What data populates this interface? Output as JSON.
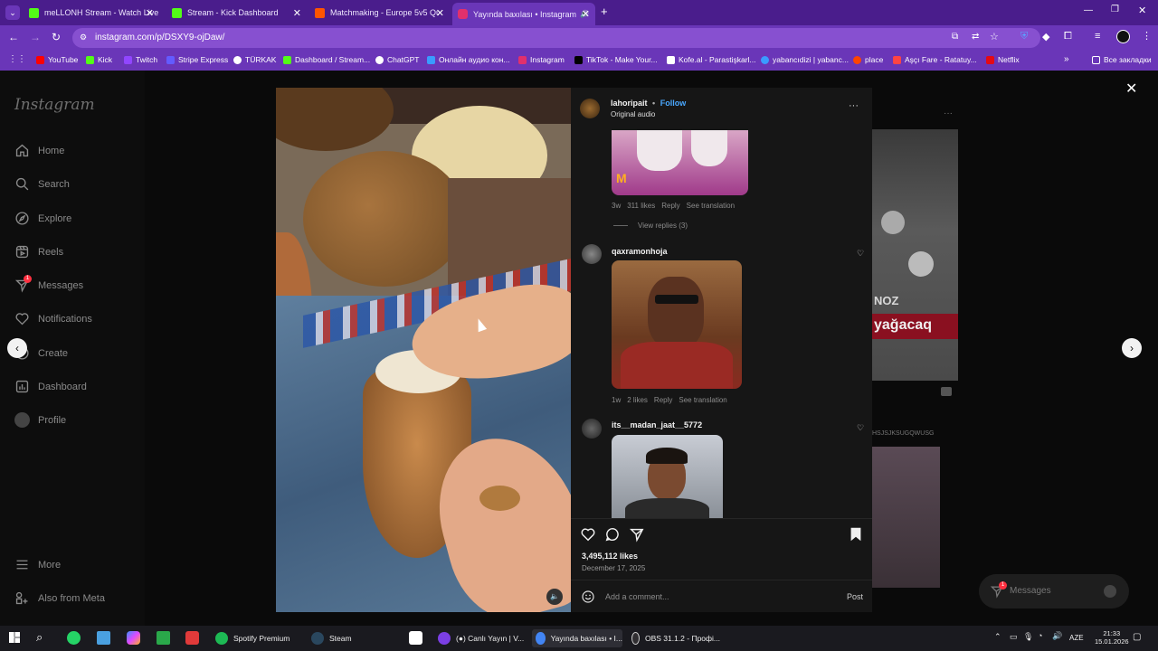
{
  "browser": {
    "tabs": [
      {
        "label": "meLLONH Stream - Watch Live",
        "icon": "kick-icon",
        "color": "#53fc18"
      },
      {
        "label": "Stream - Kick Dashboard",
        "icon": "kick-icon",
        "color": "#53fc18"
      },
      {
        "label": "Matchmaking - Europe 5v5 Qu",
        "icon": "faceit-icon",
        "color": "#ff5500"
      },
      {
        "label": "Yayında baxılası • Instagram",
        "icon": "instagram-icon",
        "color": "#e1306c"
      }
    ],
    "url": "instagram.com/p/DSXY9-ojDaw/",
    "bookmarks": [
      {
        "label": "YouTube",
        "color": "#ff0000"
      },
      {
        "label": "Kick",
        "color": "#53fc18"
      },
      {
        "label": "Twitch",
        "color": "#9146ff"
      },
      {
        "label": "Stripe Express",
        "color": "#635bff"
      },
      {
        "label": "TÜRKAK",
        "color": "#ffffff"
      },
      {
        "label": "Dashboard / Stream...",
        "color": "#53fc18"
      },
      {
        "label": "ChatGPT",
        "color": "#ffffff"
      },
      {
        "label": "Онлайн аудио кон...",
        "color": "#3a9bff"
      },
      {
        "label": "Instagram",
        "color": "#e1306c"
      },
      {
        "label": "TikTok - Make Your...",
        "color": "#000000"
      },
      {
        "label": "Kofe.al - Parastişkarl...",
        "color": "#ffffff"
      },
      {
        "label": "yabancıdizi | yabanc...",
        "color": "#3a9bff"
      },
      {
        "label": "place",
        "color": "#ff4500"
      },
      {
        "label": "Aşçı Fare - Ratatuy...",
        "color": "#ff4444"
      },
      {
        "label": "Netflix",
        "color": "#e50914"
      }
    ],
    "other_bookmarks": "Все закладки"
  },
  "sidebar": {
    "logo": "Instagram",
    "items": [
      {
        "label": "Home",
        "icon": "home-icon"
      },
      {
        "label": "Search",
        "icon": "search-icon"
      },
      {
        "label": "Explore",
        "icon": "explore-icon"
      },
      {
        "label": "Reels",
        "icon": "reels-icon"
      },
      {
        "label": "Messages",
        "icon": "messages-icon",
        "badge": "1"
      },
      {
        "label": "Notifications",
        "icon": "heart-icon"
      },
      {
        "label": "Create",
        "icon": "plus-icon"
      },
      {
        "label": "Dashboard",
        "icon": "dashboard-icon"
      },
      {
        "label": "Profile",
        "icon": "avatar"
      }
    ],
    "more": "More",
    "meta": "Also from Meta"
  },
  "post": {
    "username": "lahoripait",
    "follow": "Follow",
    "audio": "Original audio",
    "comments": [
      {
        "meta": [
          "3w",
          "311 likes",
          "Reply",
          "See translation"
        ],
        "view_replies": "View replies (3)"
      },
      {
        "user": "qaxramonhoja",
        "meta": [
          "1w",
          "2 likes",
          "Reply",
          "See translation"
        ]
      },
      {
        "user": "its__madan_jaat__5772"
      }
    ],
    "likes": "3,495,112 likes",
    "date": "December 17, 2025",
    "comment_placeholder": "Add a comment...",
    "post_button": "Post"
  },
  "background": {
    "text_noz": "NOZ",
    "text_yagacaq": "yağacaq",
    "text_user": "HSJSJKSUGQWUSG"
  },
  "messages_float": {
    "label": "Messages",
    "badge": "1"
  },
  "taskbar": {
    "items": [
      {
        "label": "Spotify Premium",
        "color": "#1db954"
      },
      {
        "label": "Steam",
        "color": "#1b2838"
      },
      {
        "label": "(●) Canlı Yayın | V...",
        "color": "#7b3fe4"
      },
      {
        "label": "Yayında baxılası • I...",
        "color": "#4285f4"
      },
      {
        "label": "OBS 31.1.2 - Профі...",
        "color": "#302e31"
      }
    ],
    "lang": "AZE",
    "time": "21:33",
    "date": "15.01.2026"
  }
}
